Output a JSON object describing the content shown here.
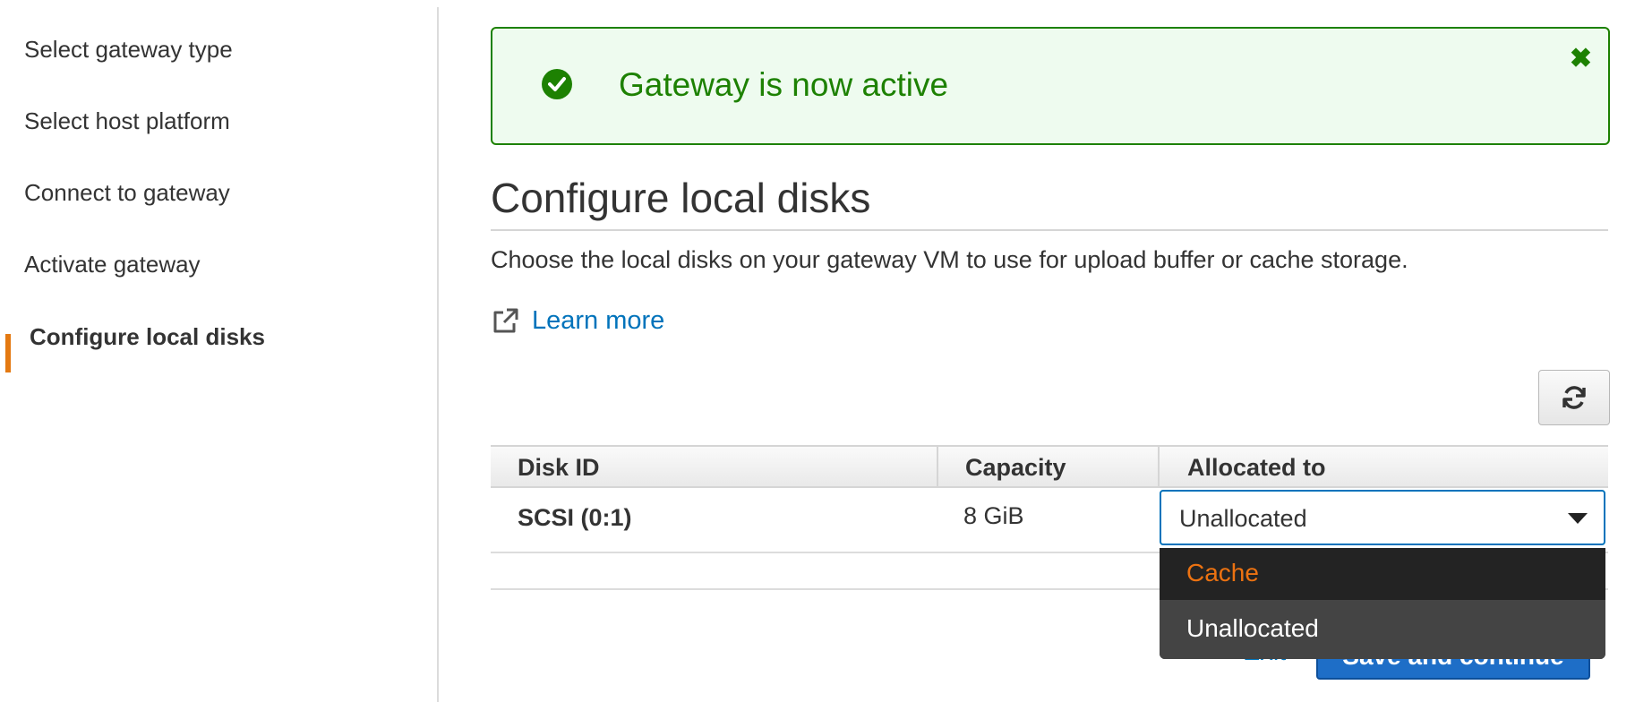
{
  "sidebar": {
    "items": [
      {
        "label": "Select gateway type"
      },
      {
        "label": "Select host platform"
      },
      {
        "label": "Connect to gateway"
      },
      {
        "label": "Activate gateway"
      },
      {
        "label": "Configure local disks",
        "active": true
      }
    ],
    "accent_color": "#e47911"
  },
  "alert": {
    "message": "Gateway is now active",
    "icon": "check-circle-icon",
    "close_icon": "close-icon",
    "close_glyph": "✖",
    "color": "#1d8102"
  },
  "main": {
    "title": "Configure local disks",
    "description": "Choose the local disks on your gateway VM to use for upload buffer or cache storage.",
    "learn_more": "Learn more",
    "refresh_icon": "refresh-icon"
  },
  "table": {
    "columns": [
      "Disk ID",
      "Capacity",
      "Allocated to"
    ],
    "rows": [
      {
        "disk_id": "SCSI (0:1)",
        "capacity": "8 GiB",
        "allocated_to": "Unallocated"
      }
    ]
  },
  "dropdown": {
    "options": [
      "Cache",
      "Unallocated"
    ],
    "hovered": "Cache",
    "selected": "Unallocated"
  },
  "footer": {
    "exit_label": "Exit",
    "save_label": "Save and continue",
    "primary_color": "#1e6ec7"
  },
  "link_color": "#0073bb"
}
